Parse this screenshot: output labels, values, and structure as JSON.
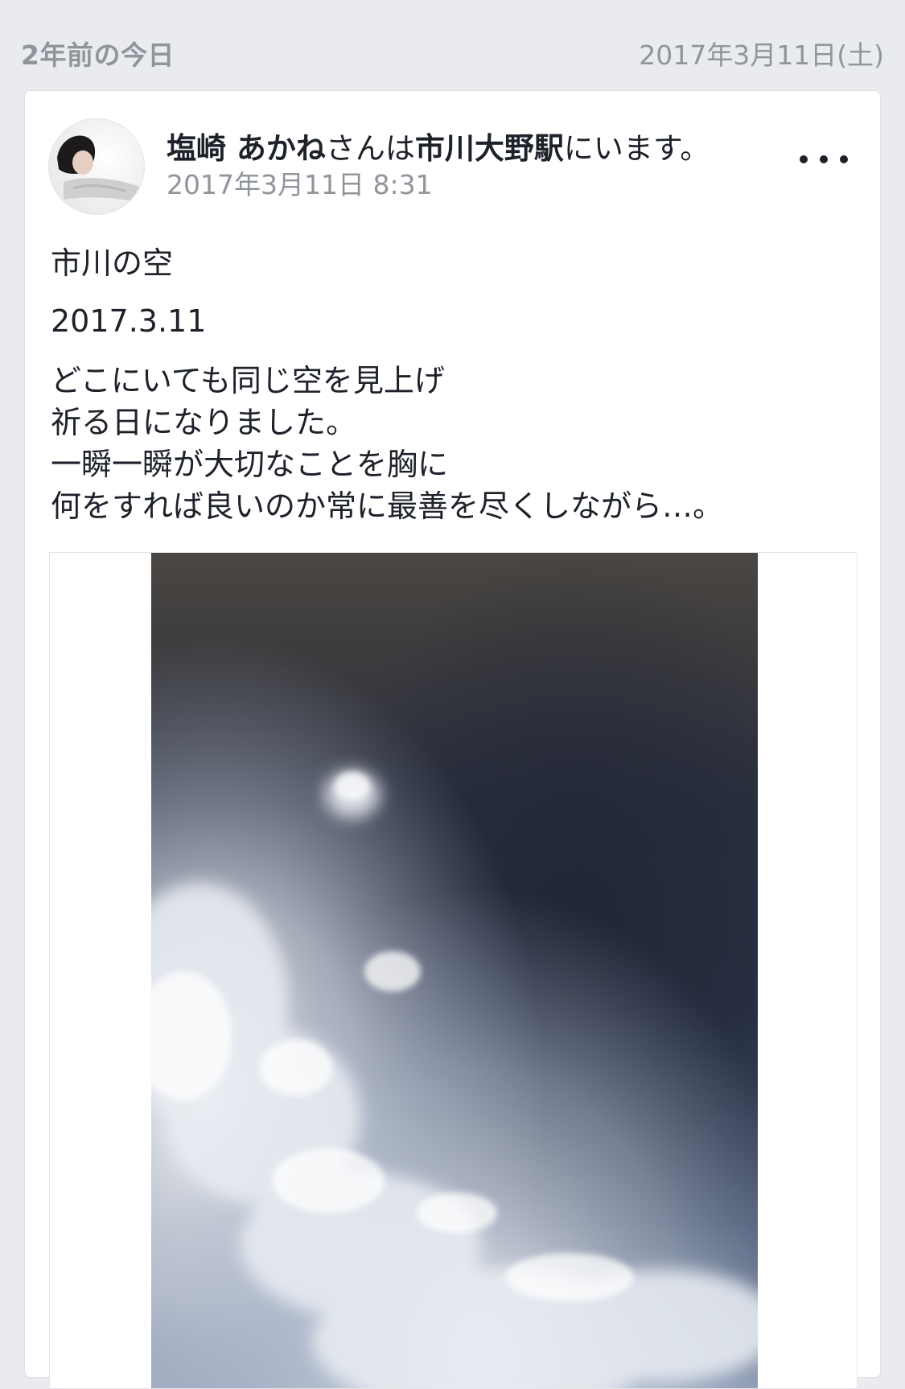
{
  "memory": {
    "label": "2年前の今日",
    "date": "2017年3月11日(土)"
  },
  "post": {
    "author": "塩崎 あかね",
    "connector": "さんは",
    "location": "市川大野駅",
    "suffix": "にいます。",
    "timestamp": "2017年3月11日 8:31",
    "title": "市川の空",
    "date_line": "2017.3.11",
    "lines": [
      "どこにいても同じ空を見上げ",
      "祈る日になりました。",
      "一瞬一瞬が大切なことを胸に",
      "何をすれば良いのか常に最善を尽くしながら…。"
    ]
  },
  "icons": {
    "more": "more-options-icon",
    "avatar": "profile-photo"
  },
  "colors": {
    "background": "#e9ebee",
    "card": "#ffffff",
    "text": "#1d2129",
    "muted": "#90949c"
  }
}
